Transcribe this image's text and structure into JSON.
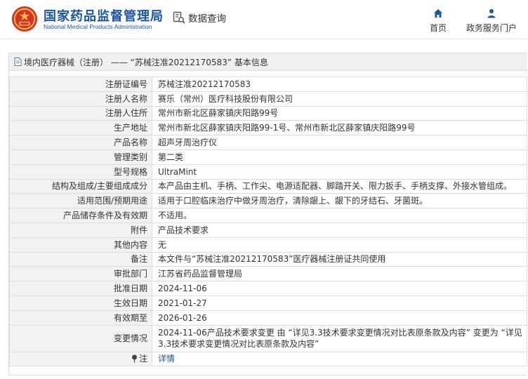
{
  "header": {
    "brand_cn": "国家药品监督管理局",
    "brand_en": "National Medical Products Administration",
    "search_label": "数据查询",
    "nav": {
      "home_label": "首页",
      "service_label": "政务服务门户"
    },
    "brand_color": "#1a56a6"
  },
  "panel": {
    "title": "境内医疗器械（注册） —— “苏械注准20212170583” 基本信息"
  },
  "rows": [
    {
      "label": "注册证编号",
      "value": "苏械注准20212170583"
    },
    {
      "label": "注册人名称",
      "value": "赛乐（常州）医疗科技股份有限公司"
    },
    {
      "label": "注册人住所",
      "value": "常州市新北区薛家镇庆阳路99号"
    },
    {
      "label": "生产地址",
      "value": "常州市新北区薛家镇庆阳路99-1号、常州市新北区薛家镇庆阳路99号"
    },
    {
      "label": "产品名称",
      "value": "超声牙周治疗仪"
    },
    {
      "label": "管理类别",
      "value": "第二类"
    },
    {
      "label": "型号规格",
      "value": "UltraMint"
    },
    {
      "label": "结构及组成/主要组成成分",
      "value": "本产品由主机、手柄、工作尖、电源适配器、脚踏开关、限力扳手、手柄支撑、外接水管组成。"
    },
    {
      "label": "适用范围/预期用途",
      "value": "适用于口腔临床治疗中做牙周治疗，清除龈上、龈下的牙结石、牙菌斑。"
    },
    {
      "label": "产品储存条件及有效期",
      "value": "不适用。"
    },
    {
      "label": "附件",
      "value": "产品技术要求"
    },
    {
      "label": "其他内容",
      "value": "无"
    },
    {
      "label": "备注",
      "value": "本文件与“苏械注准20212170583”医疗器械注册证共同使用"
    },
    {
      "label": "审批部门",
      "value": "江苏省药品监督管理局"
    },
    {
      "label": "批准日期",
      "value": "2024-11-06"
    },
    {
      "label": "生效日期",
      "value": "2021-01-27"
    },
    {
      "label": "有效期至",
      "value": "2026-01-26"
    },
    {
      "label": "变更情况",
      "value": "2024-11-06产品技术要求变更 由 “详见3.3技术要求变更情况对比表原条款及内容” 变更为 “详见3.3技术要求变更情况对比表原条款及内容”"
    }
  ],
  "note": {
    "label": "注",
    "link_text": "详情"
  }
}
